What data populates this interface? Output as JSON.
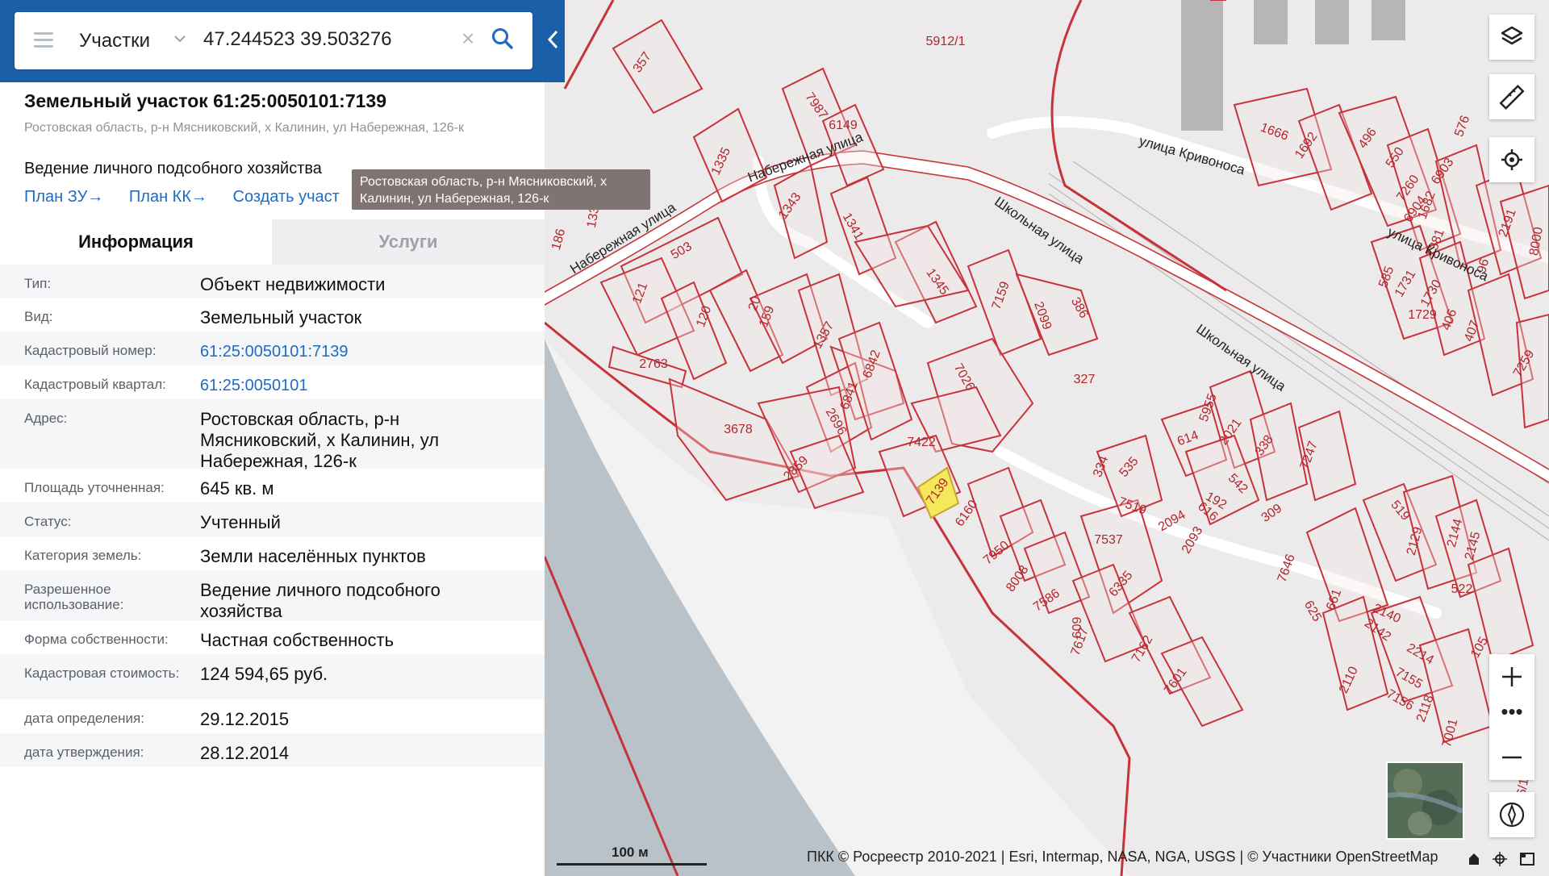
{
  "search": {
    "layer": "Участки",
    "query": "47.244523 39.503276"
  },
  "object": {
    "title": "Земельный участок 61:25:0050101:7139",
    "address_short": "Ростовская область, р-н Мясниковский, х Калинин, ул Набережная, 126-к",
    "usage": "Ведение личного подсобного хозяйства",
    "links": [
      "План ЗУ→",
      "План КК→",
      "Создать участ"
    ]
  },
  "tooltip": "Ростовская область, р-н Мясниковский, х Калинин, ул Набережная, 126-к",
  "tabs": {
    "info": "Информация",
    "services": "Услуги"
  },
  "rows": [
    {
      "label": "Тип:",
      "value": "Объект недвижимости"
    },
    {
      "label": "Вид:",
      "value": "Земельный участок"
    },
    {
      "label": "Кадастровый номер:",
      "value": "61:25:0050101:7139",
      "link": true
    },
    {
      "label": "Кадастровый квартал:",
      "value": "61:25:0050101",
      "link": true
    },
    {
      "label": "Адрес:",
      "value": "Ростовская область, р-н Мясниковский, х Калинин, ул Набережная, 126-к"
    },
    {
      "label": "Площадь уточненная:",
      "value": "645 кв. м"
    },
    {
      "label": "Статус:",
      "value": "Учтенный"
    },
    {
      "label": "Категория земель:",
      "value": "Земли населённых пунктов"
    },
    {
      "label": "Разрешенное использование:",
      "value": "Ведение личного подсобного хозяйства"
    },
    {
      "label": "Форма собственности:",
      "value": "Частная собственность"
    },
    {
      "label": "Кадастровая стоимость:",
      "value": "124 594,65 руб."
    },
    {
      "label": "дата определения:",
      "value": "29.12.2015"
    },
    {
      "label": "дата утверждения:",
      "value": "28.12.2014"
    }
  ],
  "map": {
    "streets": [
      "Набережная улица",
      "Набережная улица",
      "Школьная улица",
      "Школьная улица",
      "улица Кривоноса",
      "улица Кривоноса"
    ],
    "parcels": [
      "5912/1",
      "357",
      "7987",
      "6149",
      "1335",
      "1343",
      "1341",
      "186",
      "133",
      "503",
      "121",
      "120",
      "20",
      "159",
      "1357",
      "1345",
      "7159",
      "2099",
      "386",
      "2763",
      "3678",
      "6842",
      "6841",
      "2696",
      "7026",
      "327",
      "7422",
      "7139",
      "6160",
      "2859",
      "334",
      "535",
      "614",
      "5955",
      "2021",
      "338",
      "7247",
      "7519",
      "542",
      "192",
      "2094",
      "616",
      "2093",
      "309",
      "519",
      "2129",
      "2144",
      "2145",
      "7537",
      "7950",
      "8008",
      "7586",
      "6335",
      "7646",
      "625",
      "661",
      "2140",
      "2142",
      "522",
      "609",
      "7617",
      "7162",
      "7601",
      "2214",
      "7155",
      "7156",
      "2118",
      "105",
      "2110",
      "7001",
      "2126/1",
      "1666",
      "1692",
      "496",
      "550",
      "7260",
      "6903",
      "6904",
      "1682",
      "2191",
      "8000",
      "7381",
      "96",
      "585",
      "1731",
      "1730",
      "1729",
      "406",
      "407",
      "7259",
      "576"
    ],
    "scale": "100 м",
    "attribution": "ПКК © Росреестр 2010-2021 | Esri, Intermap, NASA, NGA, USGS | © Участники OpenStreetMap",
    "colors": {
      "parcel": "#c8323a",
      "selected": "#f6e85c",
      "header": "#1c5fa9",
      "link": "#1f6bc3"
    }
  }
}
